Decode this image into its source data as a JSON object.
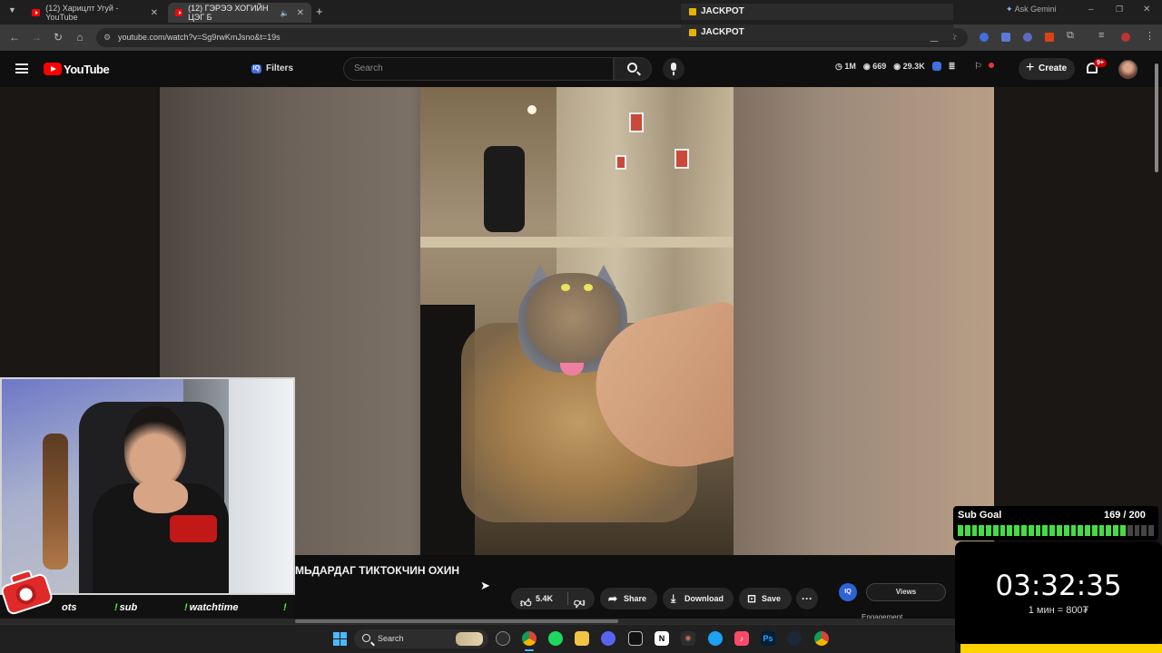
{
  "browser": {
    "tabs": [
      {
        "label": "(12) Харицлт Угуй - YouTube",
        "active": false
      },
      {
        "label": "(12) ГЭРЭЭ ХОГИЙН ЦЭГ Б",
        "active": true
      }
    ],
    "new_tab": "+",
    "url": "youtube.com/watch?v=Sg9rwKmJsno&t=19s",
    "ask_gemini": "Ask Gemini",
    "jackpot_bars": [
      "JACKPOT",
      "JACKPOT"
    ]
  },
  "youtube": {
    "logo_text": "YouTube",
    "filters_label": "Filters",
    "filters_badge": "IQ",
    "search_placeholder": "Search",
    "stats": [
      {
        "icon": "clock-icon",
        "value": "1M"
      },
      {
        "icon": "eye-icon",
        "value": "669"
      },
      {
        "icon": "eye-icon",
        "value": "29.3K"
      }
    ],
    "create_label": "Create",
    "notification_count": "9+"
  },
  "video": {
    "title": "МЬДАРДАГ ТИКТОКЧИН ОХИН",
    "like_count": "5.4K",
    "share_label": "Share",
    "download_label": "Download",
    "save_label": "Save",
    "more_label": "···",
    "iq_label": "IQ",
    "views_label": "Views",
    "engagement_label": "Engagement",
    "scroll_progress": 0.34
  },
  "stream_overlay": {
    "commands": [
      {
        "text": "ots",
        "bang": false
      },
      {
        "text": "sub",
        "bang": true
      },
      {
        "text": "watchtime",
        "bang": true
      },
      {
        "text": "!",
        "bang": false
      }
    ],
    "bot_progress": 0.89,
    "sub_goal_label": "Sub Goal",
    "sub_goal_count": "169 / 200",
    "sub_goal_current": 169,
    "sub_goal_target": 200,
    "timer": "03:32:35",
    "rate": "1 мин = 800₮"
  },
  "taskbar": {
    "search_label": "Search",
    "apps": [
      "weather-icon",
      "chatgpt-icon",
      "chrome-icon",
      "spotify-icon",
      "folder-icon",
      "discord-icon",
      "capcut-icon",
      "notion-icon",
      "claude-icon",
      "edge-icon",
      "music-icon",
      "photoshop-icon",
      "steam-icon",
      "chrome-icon"
    ]
  },
  "colors": {
    "youtube_red": "#ff0000",
    "goal_green": "#45dc45",
    "timer_bg": "#000000",
    "accent_blue": "#3f6fe0"
  }
}
